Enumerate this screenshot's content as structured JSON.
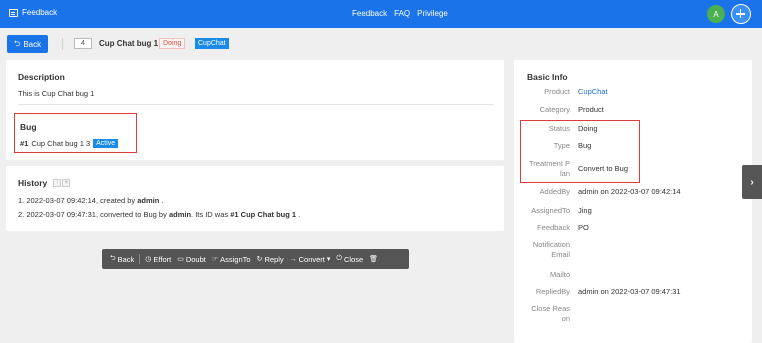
{
  "topbar": {
    "brand": "Feedback",
    "nav": [
      "Feedback",
      "FAQ",
      "Privilege"
    ],
    "avatar": "A"
  },
  "header": {
    "back_label": "Back",
    "id": "4",
    "title": "Cup Chat bug 1",
    "status": "Doing",
    "product": "CupChat"
  },
  "description": {
    "title": "Description",
    "text": "This is Cup Chat bug 1"
  },
  "bug": {
    "title": "Bug",
    "id": "#1",
    "text": "Cup Chat bug 1 3",
    "status": "Active"
  },
  "history": {
    "title": "History",
    "entries": [
      {
        "pre": "1. 2022-03-07 09:42:14, created by ",
        "user": "admin",
        "post": " ."
      },
      {
        "pre": "2. 2022-03-07 09:47:31, converted to Bug by ",
        "user": "admin",
        "mid": ". Its ID was ",
        "ref": "#1 Cup Chat bug 1",
        "post": " ."
      }
    ]
  },
  "toolbar": {
    "back": "Back",
    "effort": "Effort",
    "doubt": "Doubt",
    "assign": "AssignTo",
    "reply": "Reply",
    "convert": "Convert",
    "close": "Close"
  },
  "basic_info": {
    "title": "Basic Info",
    "product_label": "Product",
    "product_value": "CupChat",
    "category_label": "Category",
    "category_value": "Product",
    "status_label": "Status",
    "status_value": "Doing",
    "type_label": "Type",
    "type_value": "Bug",
    "treatment_label_1": "Treatment P",
    "treatment_label_2": "lan",
    "treatment_value": "Convert to Bug",
    "addedby_label": "AddedBy",
    "addedby_value": "admin on 2022-03-07 09:42:14",
    "assignedto_label": "AssignedTo",
    "assignedto_value": "Jing",
    "feedback_label": "Feedback",
    "feedback_value": "PO",
    "notification_label_1": "Notification",
    "notification_label_2": "Email",
    "mailto_label": "Mailto",
    "repliedby_label": "RepliedBy",
    "repliedby_value": "admin on 2022-03-07 09:47:31",
    "closereason_label_1": "Close Reas",
    "closereason_label_2": "on"
  },
  "colors": {
    "primary": "#1a73e8",
    "highlight_border": "#e03a3a",
    "status_doing": "#e04a3b",
    "avatar": "#4caf50",
    "toolbar_bg": "#555555"
  },
  "icons": {
    "brand": "feedback-icon",
    "add": "plus-circle-icon",
    "collapse": "chevron-right-icon"
  }
}
